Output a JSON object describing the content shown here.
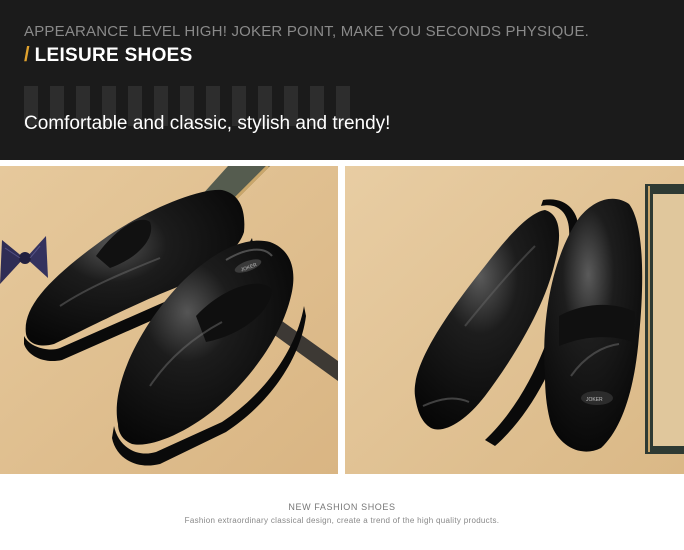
{
  "banner": {
    "headline": "APPEARANCE LEVEL HIGH! JOKER POINT, MAKE YOU SECONDS PHYSIQUE.",
    "slash": "/",
    "subtitle": "LEISURE SHOES",
    "tagline": "Comfortable and classic, stylish and trendy!"
  },
  "photos": [
    {
      "name": "photo-pair-shoes-with-bow-tie",
      "brand_mark": "JOKER"
    },
    {
      "name": "photo-pair-shoes-with-frame",
      "brand_mark": "JOKER"
    }
  ],
  "caption": {
    "title": "NEW FASHION SHOES",
    "text": "Fashion extraordinary classical design, create a trend of the high quality products."
  },
  "colors": {
    "banner_bg": "#1b1b1b",
    "accent": "#e0a22e",
    "photo_bg": "#e2c496"
  }
}
